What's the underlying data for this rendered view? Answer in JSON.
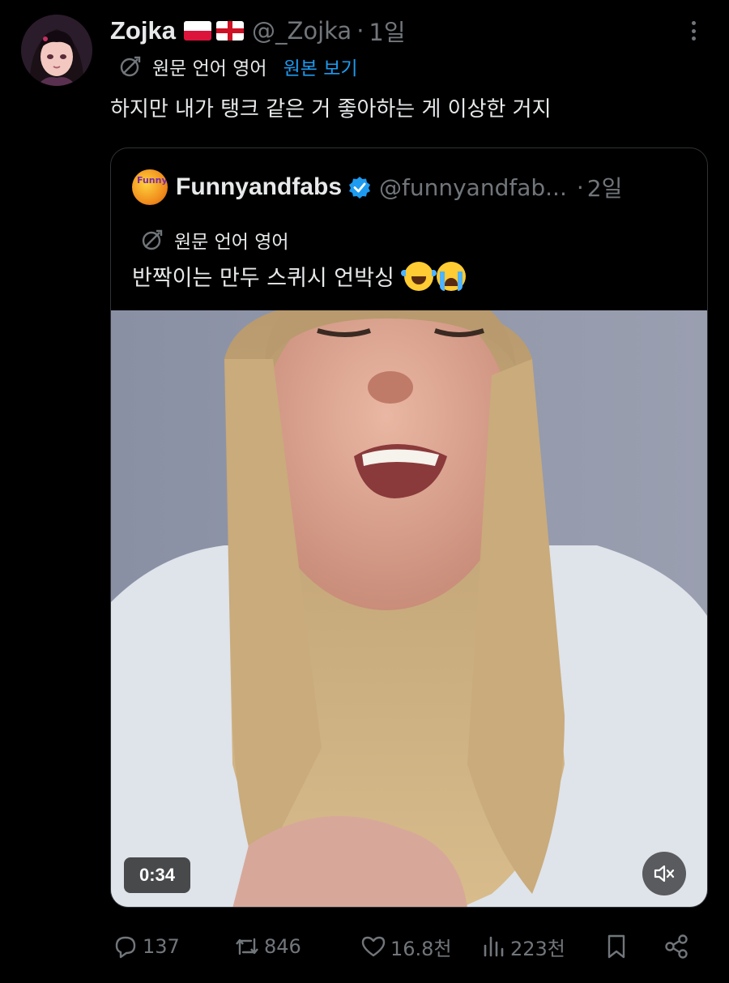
{
  "author": {
    "display_name": "Zojka",
    "flags": [
      "poland-flag",
      "england-flag"
    ],
    "handle": "@_Zojka",
    "separator": "·",
    "time": "1일"
  },
  "translation": {
    "note": "원문 언어 영어",
    "show_original": "원본 보기"
  },
  "post_text": "하지만 내가 탱크 같은 거 좋아하는 게 이상한 거지",
  "quoted": {
    "avatar_text": "Funny Fabs",
    "display_name": "Funnyandfabs",
    "handle": "@funnyandfab...",
    "separator": "·",
    "time": "2일",
    "translation_note": "원문 언어 영어",
    "text": "반짝이는 만두 스퀴시 언박싱",
    "emojis": [
      "laughing-crying-emoji",
      "loudly-crying-emoji"
    ],
    "video": {
      "duration": "0:34",
      "muted": true
    }
  },
  "actions": {
    "replies": "137",
    "reposts": "846",
    "likes": "16.8천",
    "views": "223천"
  },
  "colors": {
    "background": "#000000",
    "text": "#e7e9ea",
    "muted": "#71767b",
    "link": "#1d9bf0",
    "verified": "#1d9bf0"
  }
}
